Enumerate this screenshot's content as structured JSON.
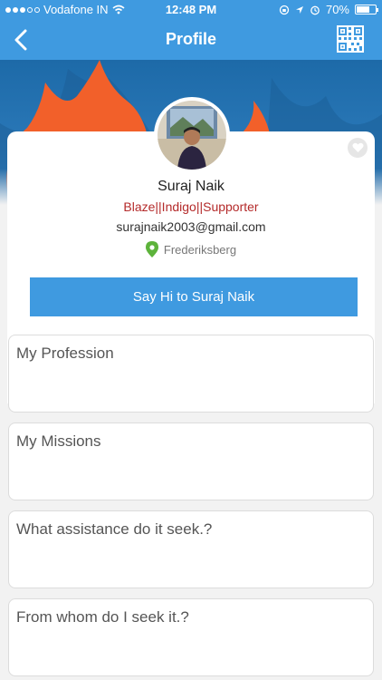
{
  "status_bar": {
    "carrier": "Vodafone IN",
    "time": "12:48 PM",
    "battery_percent": "70%",
    "battery_level": 0.7
  },
  "nav": {
    "title": "Profile",
    "back_icon": "chevron-left-icon",
    "qr_icon": "qr-code-icon"
  },
  "profile": {
    "name": "Suraj Naik",
    "tags": "Blaze||Indigo||Supporter",
    "email": "surajnaik2003@gmail.com",
    "location": "Frederiksberg"
  },
  "say_hi_label": "Say Hi to Suraj Naik",
  "sections": [
    {
      "label": "My Profession"
    },
    {
      "label": "My Missions"
    },
    {
      "label": "What assistance do it seek.?"
    },
    {
      "label": "From whom do I seek it.?"
    }
  ],
  "colors": {
    "accent": "#3f9ae0",
    "tags": "#b42a2a",
    "location_pin": "#5db33b"
  }
}
